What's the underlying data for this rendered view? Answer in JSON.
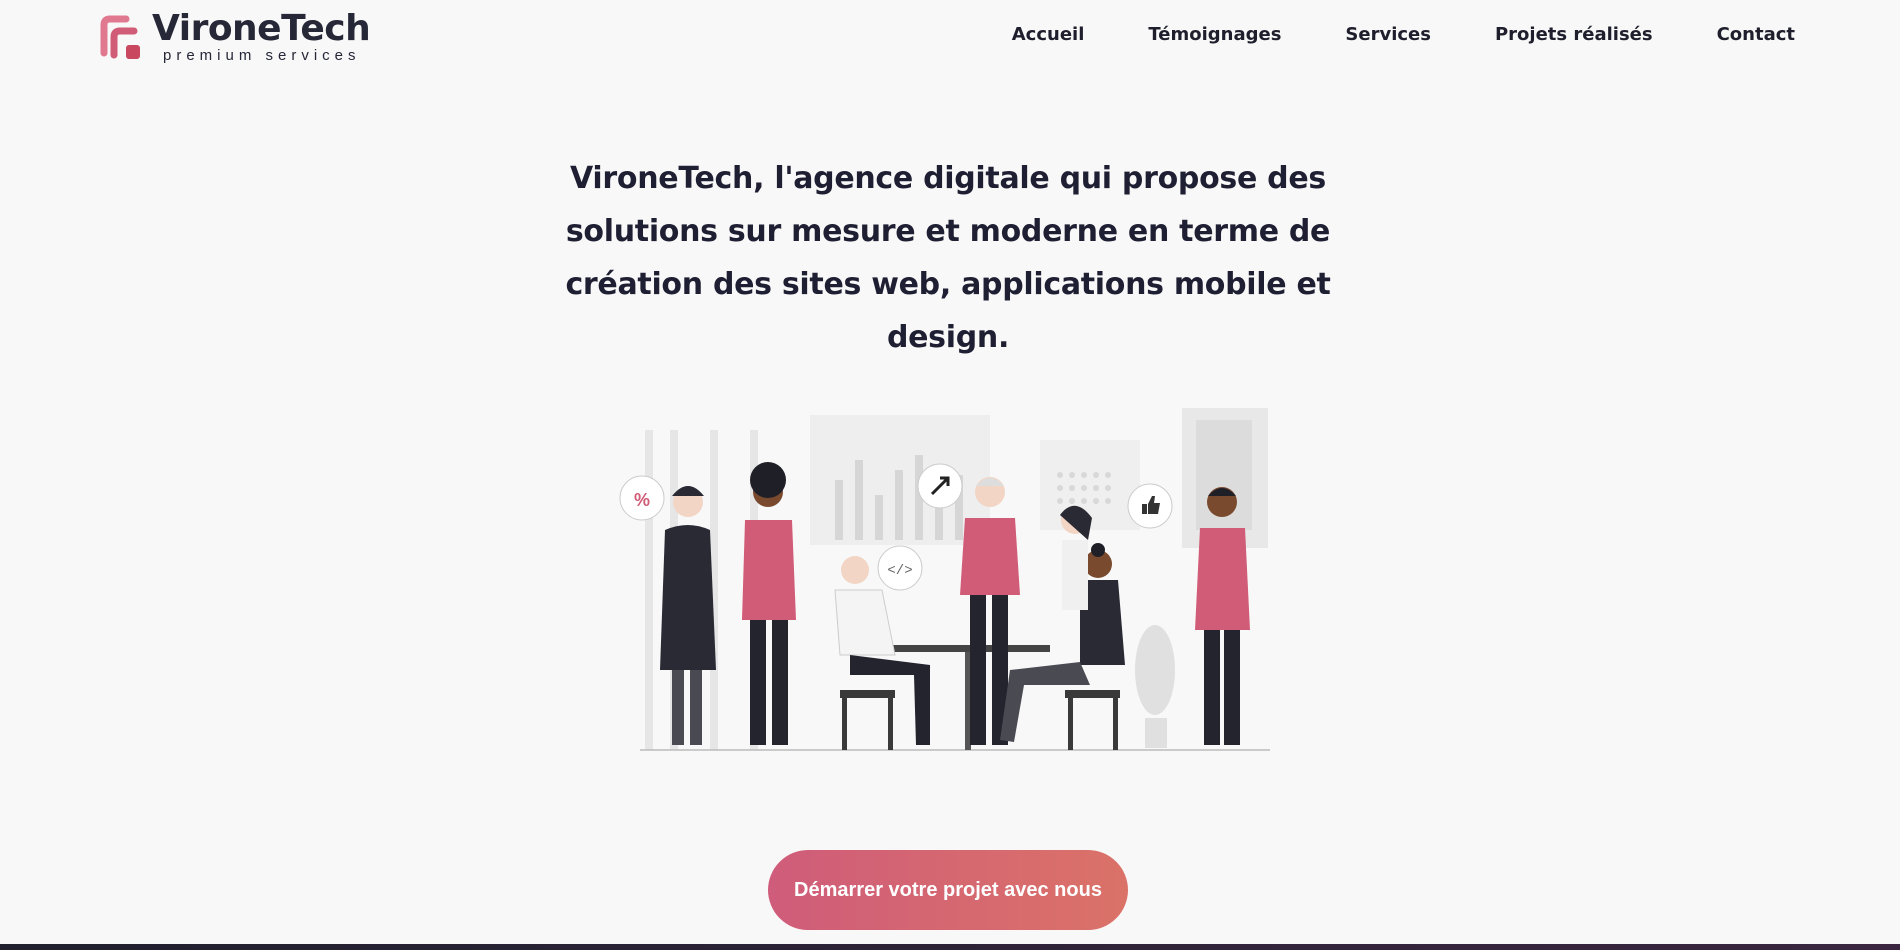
{
  "brand": {
    "name": "ViRoneTech",
    "name_display": "VironeTech",
    "tagline": "premium services",
    "accent": "#d15c77"
  },
  "nav": {
    "items": [
      {
        "label": "Accueil"
      },
      {
        "label": "Témoignages"
      },
      {
        "label": "Services"
      },
      {
        "label": "Projets réalisés"
      },
      {
        "label": "Contact"
      }
    ]
  },
  "hero": {
    "text": "VironeTech, l'agence digitale qui propose des solutions sur mesure et moderne en terme de création des sites web, applications mobile et design.",
    "illustration_bubbles": [
      "%",
      "</>"
    ]
  },
  "cta": {
    "label": "Démarrer votre projet avec nous",
    "gradient_start": "#cf5c7a",
    "gradient_end": "#db7268"
  }
}
